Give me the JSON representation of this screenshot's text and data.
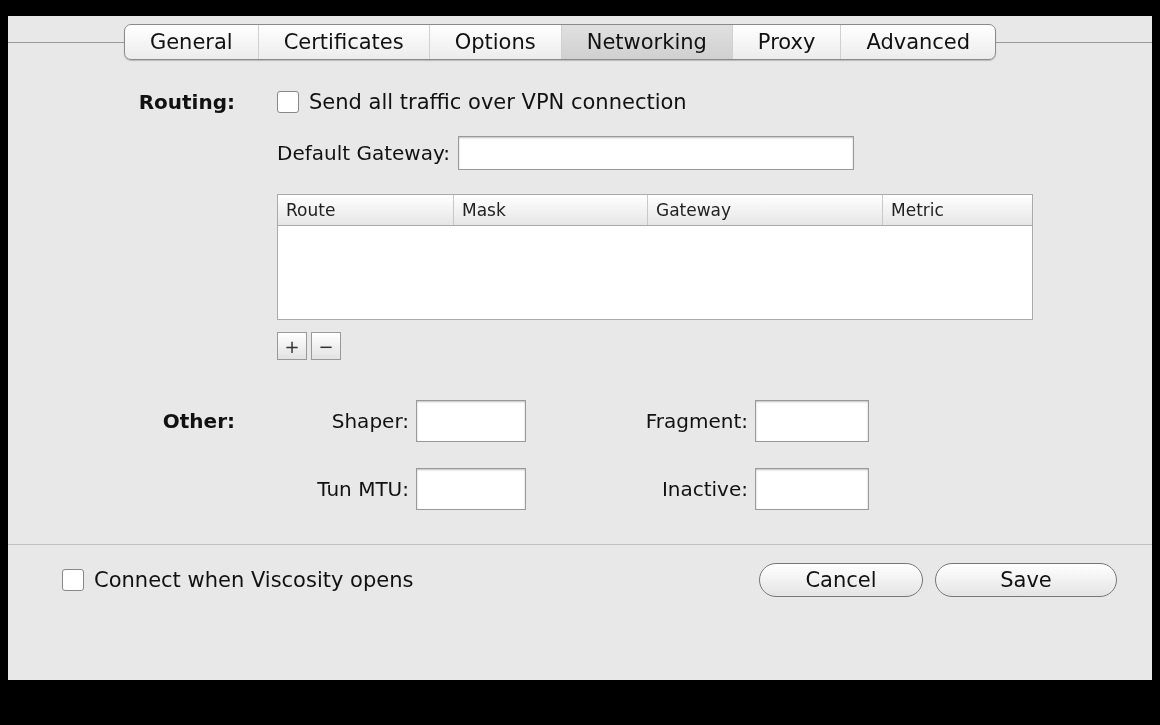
{
  "tabs": [
    {
      "label": "General",
      "selected": false
    },
    {
      "label": "Certificates",
      "selected": false
    },
    {
      "label": "Options",
      "selected": false
    },
    {
      "label": "Networking",
      "selected": true
    },
    {
      "label": "Proxy",
      "selected": false
    },
    {
      "label": "Advanced",
      "selected": false
    }
  ],
  "routing": {
    "label": "Routing:",
    "send_all": {
      "label": "Send all traffic over VPN connection",
      "checked": false
    },
    "default_gateway": {
      "label": "Default Gateway:"
    }
  },
  "routes_table": {
    "columns": [
      "Route",
      "Mask",
      "Gateway",
      "Metric"
    ],
    "buttons": [
      "+",
      "−"
    ]
  },
  "other": {
    "label": "Other:",
    "fields": [
      {
        "label": "Shaper:"
      },
      {
        "label": "Fragment:"
      },
      {
        "label": "Tun MTU:"
      },
      {
        "label": "Inactive:"
      }
    ]
  },
  "connect_on_open": {
    "label": "Connect when Viscosity opens",
    "checked": false
  },
  "buttons": [
    "Cancel",
    "Save"
  ]
}
